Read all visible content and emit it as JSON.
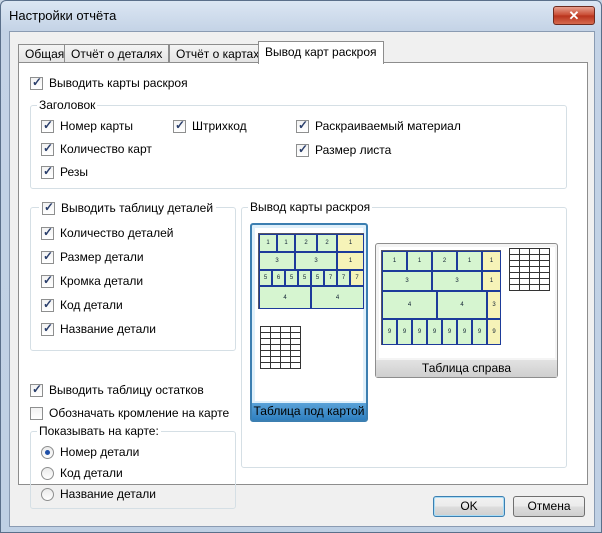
{
  "window": {
    "title": "Настройки отчёта",
    "close_glyph": "✕"
  },
  "tabs": [
    {
      "label": "Общая",
      "active": false
    },
    {
      "label": "Отчёт о деталях",
      "active": false
    },
    {
      "label": "Отчёт о картах",
      "active": false
    },
    {
      "label": "Вывод карт раскроя",
      "active": true
    }
  ],
  "main": {
    "print_maps": {
      "label": "Выводить карты раскроя",
      "checked": true
    },
    "header_group": {
      "label": "Заголовок",
      "items": [
        {
          "label": "Номер карты",
          "checked": true
        },
        {
          "label": "Количество карт",
          "checked": true
        },
        {
          "label": "Резы",
          "checked": true
        },
        {
          "label": "Штрихкод",
          "checked": true
        },
        {
          "label": "Раскраиваемый материал",
          "checked": true
        },
        {
          "label": "Размер листа",
          "checked": true
        }
      ]
    },
    "details_group": {
      "label": "Выводить таблицу деталей",
      "checked": true,
      "items": [
        {
          "label": "Количество деталей",
          "checked": true
        },
        {
          "label": "Размер детали",
          "checked": true
        },
        {
          "label": "Кромка детали",
          "checked": true
        },
        {
          "label": "Код детали",
          "checked": true
        },
        {
          "label": "Название детали",
          "checked": true
        }
      ]
    },
    "remains_table": {
      "label": "Выводить таблицу остатков",
      "checked": true
    },
    "mark_edging": {
      "label": "Обозначать кромление на карте",
      "checked": false
    },
    "show_on_map": {
      "label": "Показывать на карте:",
      "options": [
        {
          "label": "Номер детали",
          "checked": true
        },
        {
          "label": "Код детали",
          "checked": false
        },
        {
          "label": "Название детали",
          "checked": false
        }
      ]
    },
    "layout_group": {
      "label": "Вывод карты раскроя",
      "options": [
        {
          "caption": "Таблица под картой",
          "selected": true
        },
        {
          "caption": "Таблица справа",
          "selected": false
        }
      ]
    }
  },
  "buttons": {
    "ok": "OK",
    "cancel": "Отмена"
  },
  "colors": {
    "sheet_part": "#d6f5d0",
    "waste": "#f6f3b8",
    "selection": "#3c7fb1"
  }
}
